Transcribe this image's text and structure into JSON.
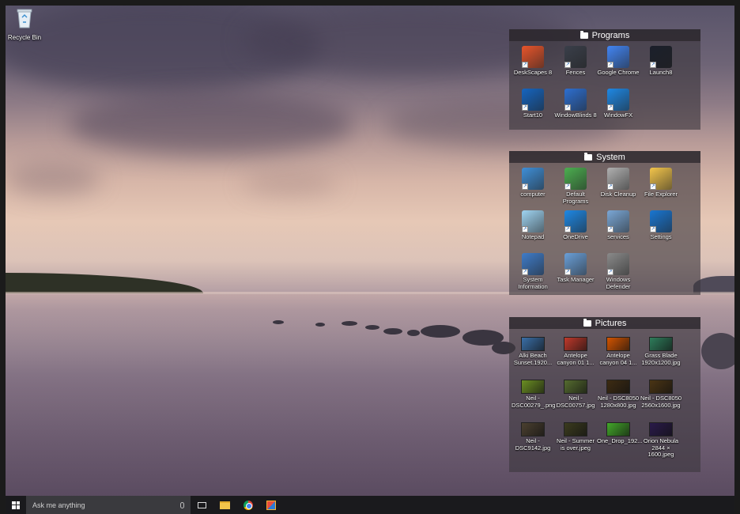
{
  "desktop": {
    "recycle_bin_label": "Recycle Bin"
  },
  "fences": [
    {
      "title": "Programs",
      "items": [
        {
          "label": "DeskScapes 8",
          "icon": "deskscapes-icon",
          "color": "#e8552b"
        },
        {
          "label": "Fences",
          "icon": "fences-icon",
          "color": "#3a3f4a"
        },
        {
          "label": "Google Chrome",
          "icon": "chrome-icon",
          "color": "#4285f4"
        },
        {
          "label": "Launch8",
          "icon": "launch8-icon",
          "color": "#1b1f2b"
        },
        {
          "label": "Start10",
          "icon": "start10-icon",
          "color": "#1565c0"
        },
        {
          "label": "WindowBlinds 8",
          "icon": "windowblinds-icon",
          "color": "#2d6fd1"
        },
        {
          "label": "WindowFX",
          "icon": "windowfx-icon",
          "color": "#1e88e5"
        }
      ]
    },
    {
      "title": "System",
      "items": [
        {
          "label": "computer",
          "icon": "computer-icon",
          "color": "#3f8fd8"
        },
        {
          "label": "Default\nPrograms",
          "icon": "default-programs-icon",
          "color": "#4caf50"
        },
        {
          "label": "Disk Cleanup",
          "icon": "disk-cleanup-icon",
          "color": "#b0b0b0"
        },
        {
          "label": "File Explorer",
          "icon": "file-explorer-icon",
          "color": "#f3c54b"
        },
        {
          "label": "Notepad",
          "icon": "notepad-icon",
          "color": "#9fd4f2"
        },
        {
          "label": "OneDrive",
          "icon": "onedrive-icon",
          "color": "#1e88e5"
        },
        {
          "label": "services",
          "icon": "services-icon",
          "color": "#7aa7d6"
        },
        {
          "label": "Settings",
          "icon": "settings-icon",
          "color": "#1976d2"
        },
        {
          "label": "System\nInformation",
          "icon": "system-information-icon",
          "color": "#3f7cc9"
        },
        {
          "label": "Task Manager",
          "icon": "task-manager-icon",
          "color": "#6a9fd8"
        },
        {
          "label": "Windows\nDefender",
          "icon": "windows-defender-icon",
          "color": "#8a8a8a"
        }
      ]
    },
    {
      "title": "Pictures",
      "items": [
        {
          "label": "Alki Beach\nSunset.1920...",
          "icon": "image-thumbnail-icon",
          "color": "#3a6fa8"
        },
        {
          "label": "Antelope\ncanyon 01 1...",
          "icon": "image-thumbnail-icon",
          "color": "#c0392b"
        },
        {
          "label": "Antelope\ncanyon 04 1...",
          "icon": "image-thumbnail-icon",
          "color": "#d35400"
        },
        {
          "label": "Grass Blade\n1920x1200.jpg",
          "icon": "image-thumbnail-icon",
          "color": "#2e7d5b"
        },
        {
          "label": "Neil -\nDSC00279_.png",
          "icon": "image-thumbnail-icon",
          "color": "#6b8e23"
        },
        {
          "label": "Neil -\nDSC00757.jpg",
          "icon": "image-thumbnail-icon",
          "color": "#556b2f"
        },
        {
          "label": "Neil - DSC8050\n1280x800.jpg",
          "icon": "image-thumbnail-icon",
          "color": "#3d2b12"
        },
        {
          "label": "Neil - DSC8050\n2560x1600.jpg",
          "icon": "image-thumbnail-icon",
          "color": "#4a3414"
        },
        {
          "label": "Neil -\nDSC9142.jpg",
          "icon": "image-thumbnail-icon",
          "color": "#4b4030"
        },
        {
          "label": "Neil - Summer\nis over.jpeg",
          "icon": "image-thumbnail-icon",
          "color": "#3b3b1e"
        },
        {
          "label": "One_Drop_192...",
          "icon": "image-thumbnail-icon",
          "color": "#43a82a"
        },
        {
          "label": "Orion Nebula\n2844 × 1600.jpeg",
          "icon": "image-thumbnail-icon",
          "color": "#2a1a4a"
        }
      ]
    }
  ],
  "taskbar": {
    "search_placeholder": "Ask me anything",
    "pinned": [
      "task-view-icon",
      "file-explorer-icon",
      "chrome-icon",
      "windows-store-icon"
    ]
  }
}
